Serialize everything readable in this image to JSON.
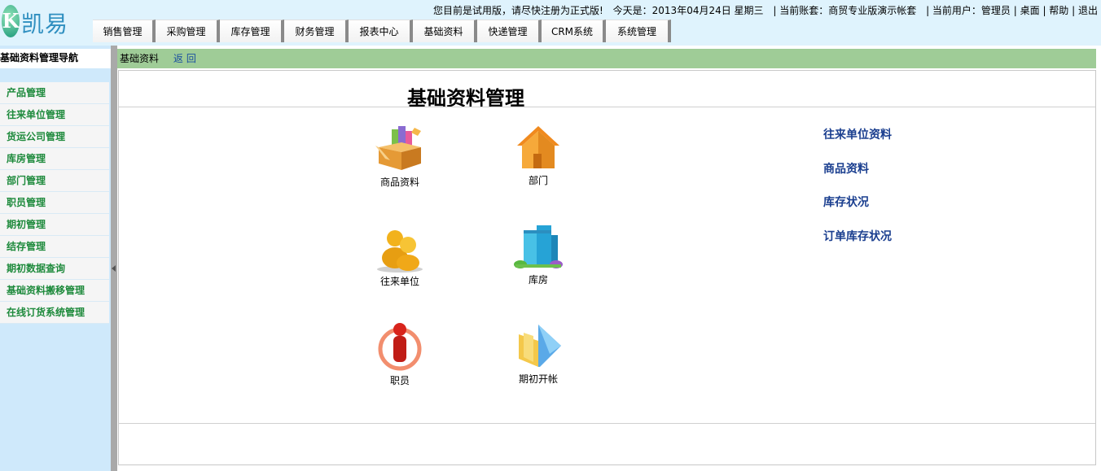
{
  "app": {
    "logo_letter": "K",
    "logo_text": "凯易通"
  },
  "topbar": {
    "notice": "您目前是试用版，请尽快注册为正式版!",
    "today": "今天是：2013年04月24日  星期三",
    "account": "| 当前账套：商贸专业版演示帐套",
    "user": "| 当前用户：管理员",
    "desktop": "| 桌面",
    "help": "| 帮助",
    "logout": "| 退出"
  },
  "nav": {
    "tabs": [
      "销售管理",
      "采购管理",
      "库存管理",
      "财务管理",
      "报表中心",
      "基础资料",
      "快递管理",
      "CRM系统",
      "系统管理"
    ]
  },
  "sidebar": {
    "title": "基础资料管理导航",
    "items": [
      "产品管理",
      "往来单位管理",
      "货运公司管理",
      "库房管理",
      "部门管理",
      "职员管理",
      "期初管理",
      "结存管理",
      "期初数据查询",
      "基础资料搬移管理",
      "在线订货系统管理"
    ]
  },
  "breadcrumb": {
    "current": "基础资料",
    "back": "返回"
  },
  "main": {
    "title": "基础资料管理",
    "tiles": [
      {
        "label": "商品资料",
        "icon": "goods-box-icon"
      },
      {
        "label": "部门",
        "icon": "house-icon"
      },
      {
        "label": "往来单位",
        "icon": "people-icon"
      },
      {
        "label": "库房",
        "icon": "buildings-icon"
      },
      {
        "label": "职员",
        "icon": "staff-icon"
      },
      {
        "label": "期初开帐",
        "icon": "ledger-icon"
      }
    ],
    "quick_links": [
      "往来单位资料",
      "商品资料",
      "库存状况",
      "订单库存状况"
    ]
  },
  "colors": {
    "header_bg": "#dff3fd",
    "sidebar_bg": "#cfe9fb",
    "sidebar_text": "#1e8a3c",
    "crumb_bg": "#9fcc97",
    "link": "#1a3e8f"
  }
}
